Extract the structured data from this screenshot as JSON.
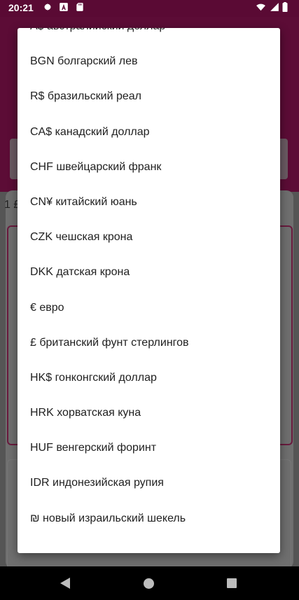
{
  "status_bar": {
    "time": "20:21",
    "left_icons": [
      "gear-icon",
      "font-a-icon",
      "sd-card-icon"
    ],
    "right_icons": [
      "wifi-icon",
      "signal-icon",
      "battery-icon"
    ]
  },
  "background": {
    "value_label": "1 £"
  },
  "currency_menu": {
    "items": [
      "A$ австралийский доллар",
      "BGN болгарский лев",
      "R$ бразильский реал",
      "CA$ канадский доллар",
      "CHF швейцарский франк",
      "CN¥ китайский юань",
      "CZK чешская крона",
      "DKK датская крона",
      "€ евро",
      "£ британский фунт стерлингов",
      "HK$ гонконгский доллар",
      "HRK хорватская куна",
      "HUF венгерский форинт",
      "IDR индонезийская рупия",
      "₪ новый израильский шекель"
    ]
  },
  "nav_bar": {
    "icons": [
      "back-icon",
      "home-icon",
      "recents-icon"
    ]
  },
  "colors": {
    "status_bar": "#5a0a34",
    "nav_bar": "#000000",
    "menu_background": "#ffffff",
    "menu_text": "#212121"
  }
}
